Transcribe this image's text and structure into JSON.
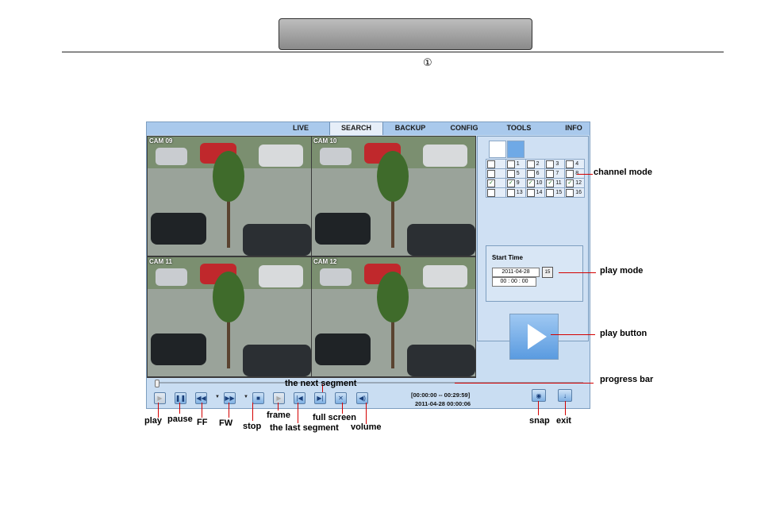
{
  "page": {
    "circle_number": "①"
  },
  "menu": [
    "LIVE",
    "SEARCH",
    "BACKUP",
    "CONFIG",
    "TOOLS",
    "INFO"
  ],
  "menu_active": "SEARCH",
  "cameras": [
    "CAM 09",
    "CAM 10",
    "CAM 11",
    "CAM 12"
  ],
  "channels": [
    [
      {
        "n": "",
        "c": false
      },
      {
        "n": "1",
        "c": false
      },
      {
        "n": "2",
        "c": false
      },
      {
        "n": "3",
        "c": false
      },
      {
        "n": "4",
        "c": false
      }
    ],
    [
      {
        "n": "",
        "c": false
      },
      {
        "n": "5",
        "c": false
      },
      {
        "n": "6",
        "c": false
      },
      {
        "n": "7",
        "c": false
      },
      {
        "n": "8",
        "c": false
      }
    ],
    [
      {
        "n": "",
        "c": true
      },
      {
        "n": "9",
        "c": true
      },
      {
        "n": "10",
        "c": true
      },
      {
        "n": "11",
        "c": true
      },
      {
        "n": "12",
        "c": true
      }
    ],
    [
      {
        "n": "",
        "c": false
      },
      {
        "n": "13",
        "c": false
      },
      {
        "n": "14",
        "c": false
      },
      {
        "n": "15",
        "c": false
      },
      {
        "n": "16",
        "c": false
      }
    ]
  ],
  "start_time": {
    "title": "Start Time",
    "date": "2011-04-28",
    "time": "00 : 00 : 00",
    "calendar_day": "15"
  },
  "playback": {
    "range": "[00:00:00 -- 00:29:59]",
    "current": "2011-04-28 00:00:06"
  },
  "callouts": {
    "channel_mode": "channel mode",
    "play_mode": "play mode",
    "play_button": "play button",
    "progress_bar": "progress bar",
    "play": "play",
    "pause": "pause",
    "ff": "FF",
    "fw": "FW",
    "stop": "stop",
    "frame": "frame",
    "last_segment": "the last segment",
    "next_segment": "the next segment",
    "full_screen": "full screen",
    "volume": "volume",
    "snap": "snap",
    "exit": "exit"
  },
  "colors": {
    "accent": "#d40000",
    "panel": "#c9ddf2",
    "menu": "#a9c9ec"
  }
}
